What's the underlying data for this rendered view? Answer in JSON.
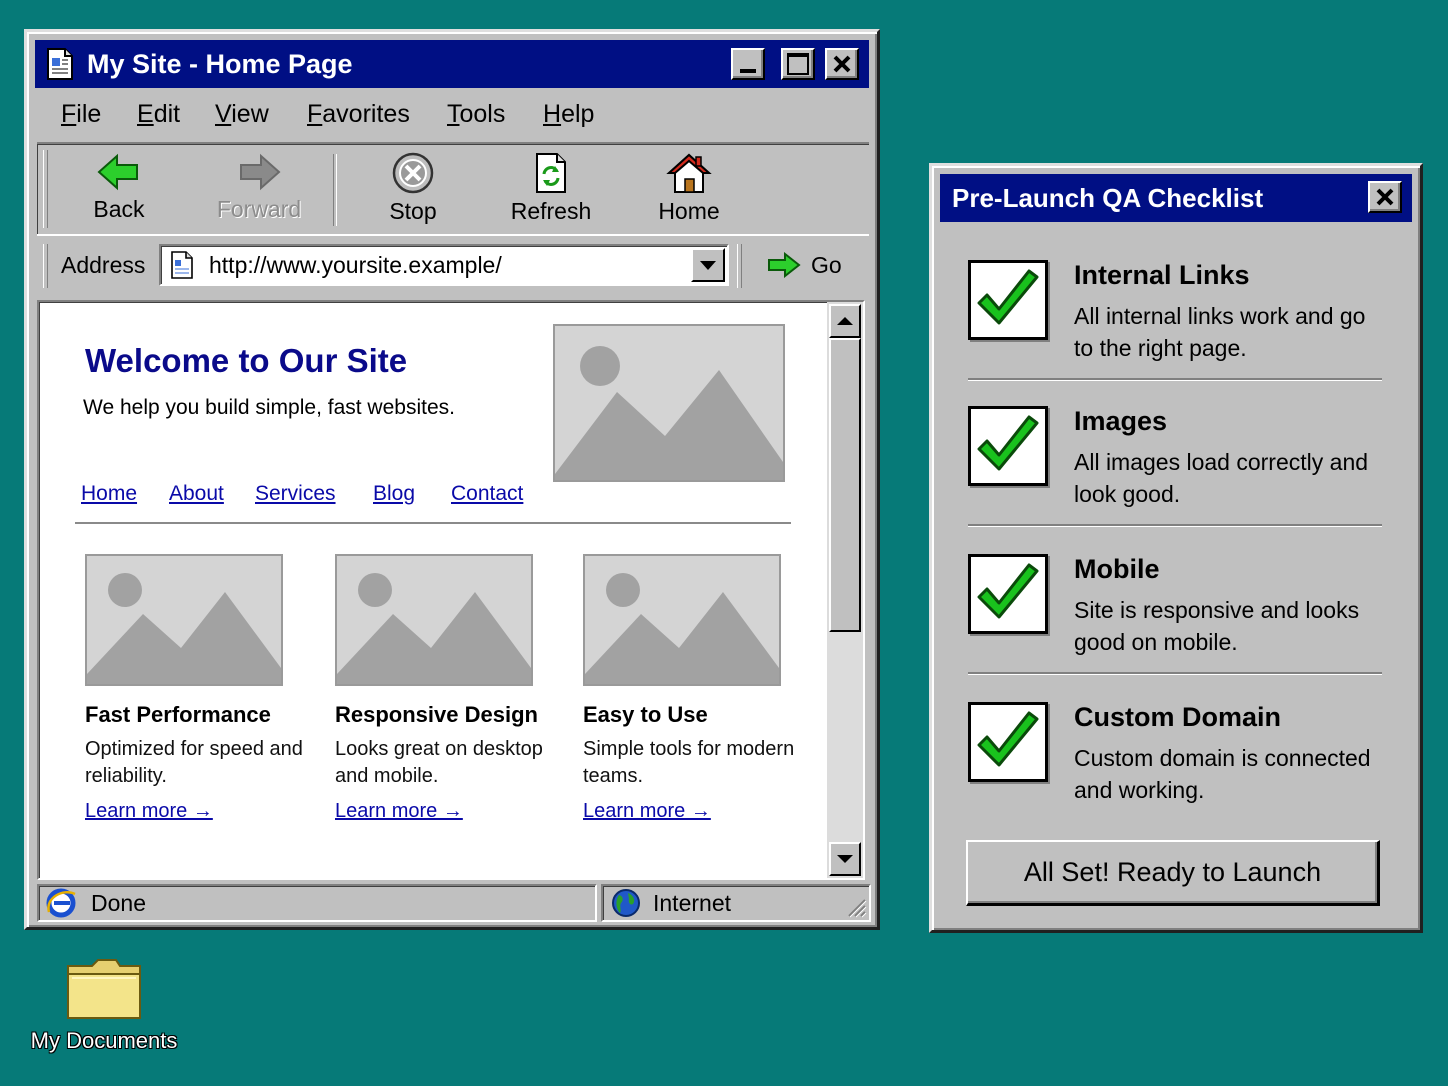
{
  "browser": {
    "title": "My Site - Home Page",
    "menu": [
      {
        "accel": "F",
        "rest": "ile"
      },
      {
        "accel": "E",
        "rest": "dit"
      },
      {
        "accel": "V",
        "rest": "iew"
      },
      {
        "accel": "F",
        "rest": "avorites"
      },
      {
        "accel": "T",
        "rest": "ools"
      },
      {
        "accel": "H",
        "rest": "elp"
      }
    ],
    "toolbar": {
      "back": "Back",
      "forward": "Forward",
      "stop": "Stop",
      "refresh": "Refresh",
      "home": "Home"
    },
    "address": {
      "label": "Address",
      "url": "http://www.yoursite.example/",
      "go": "Go"
    },
    "page": {
      "heading": "Welcome to Our Site",
      "tagline": "We help you build simple, fast websites.",
      "nav": [
        "Home",
        "About",
        "Services",
        "Blog",
        "Contact"
      ],
      "cards": [
        {
          "title": "Fast Performance",
          "text": "Optimized for speed and reliability.",
          "link": "Learn more →"
        },
        {
          "title": "Responsive Design",
          "text": "Looks great on desktop and mobile.",
          "link": "Learn more →"
        },
        {
          "title": "Easy to Use",
          "text": "Simple tools for modern teams.",
          "link": "Learn more →"
        }
      ]
    },
    "status": {
      "text": "Done",
      "zone": "Internet"
    }
  },
  "checklist": {
    "title": "Pre-Launch QA Checklist",
    "items": [
      {
        "title": "Internal Links",
        "desc": "All internal links work and go to the right page.",
        "checked": true
      },
      {
        "title": "Images",
        "desc": "All images load correctly and look good.",
        "checked": true
      },
      {
        "title": "Mobile",
        "desc": "Site is responsive and looks good on mobile.",
        "checked": true
      },
      {
        "title": "Custom Domain",
        "desc": "Custom domain is connected and working.",
        "checked": true
      }
    ],
    "button": "All Set! Ready to Launch"
  },
  "desktop": {
    "icons": [
      {
        "label": "My Documents",
        "icon": "folder-icon"
      }
    ]
  },
  "colors": {
    "desktop": "#067a78",
    "titlebar": "#000f84",
    "link": "#0a0aa8",
    "check": "#19c21d"
  }
}
